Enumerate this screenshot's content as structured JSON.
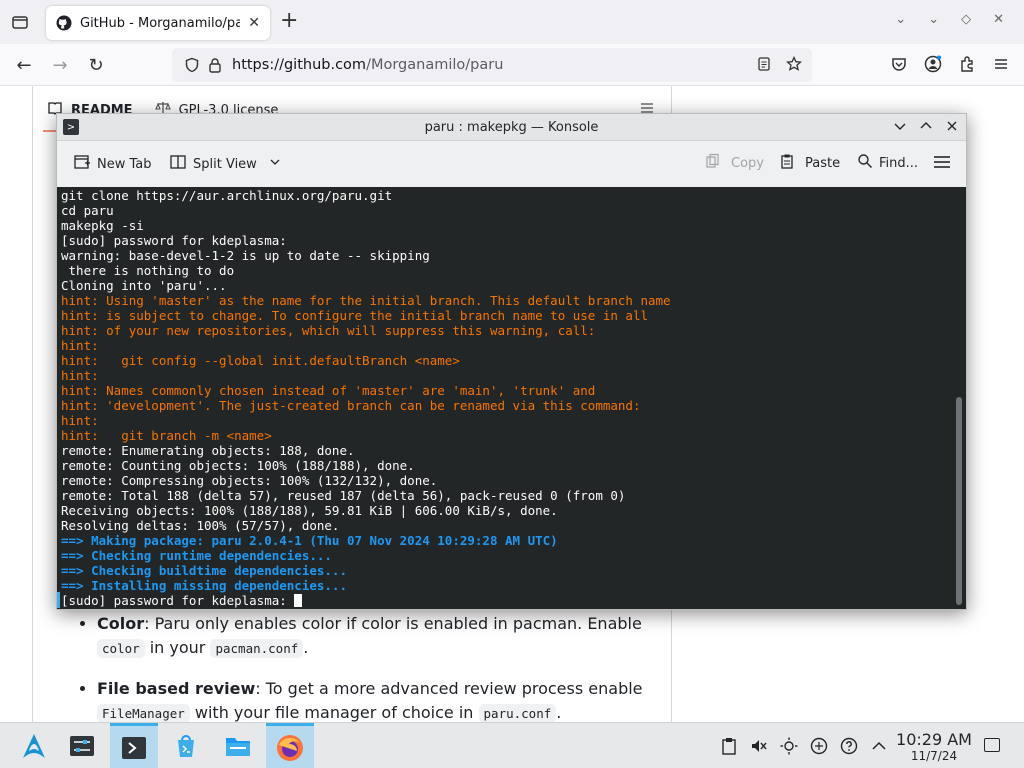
{
  "browser": {
    "tab_title": "GitHub - Morganamilo/paru",
    "url_host": "https://github.com",
    "url_path": "/Morganamilo/paru"
  },
  "github": {
    "tabs": [
      "README",
      "GPL-3.0 license"
    ],
    "readme_items": [
      {
        "bold": "Color",
        "text1": ": Paru only enables color if color is enabled in pacman. Enable ",
        "code1": "color",
        "text2": " in your ",
        "code2": "pacman.conf",
        "text3": "."
      },
      {
        "bold": "File based review",
        "text1": ": To get a more advanced review process enable ",
        "code1": "FileManager",
        "text2": " with your file manager of choice in ",
        "code2": "paru.conf",
        "text3": "."
      }
    ]
  },
  "konsole": {
    "title": "paru : makepkg — Konsole",
    "toolbar": {
      "new_tab": "New Tab",
      "split_view": "Split View",
      "copy": "Copy",
      "paste": "Paste",
      "find": "Find..."
    },
    "lines": [
      {
        "text": "git clone https://aur.archlinux.org/paru.git",
        "color": "white"
      },
      {
        "text": "cd paru",
        "color": "white"
      },
      {
        "text": "makepkg -si",
        "color": "white"
      },
      {
        "text": "[sudo] password for kdeplasma:",
        "color": "white"
      },
      {
        "text": "warning: base-devel-1-2 is up to date -- skipping",
        "color": "white"
      },
      {
        "text": " there is nothing to do",
        "color": "white"
      },
      {
        "text": "Cloning into 'paru'...",
        "color": "white"
      },
      {
        "text": "hint: Using 'master' as the name for the initial branch. This default branch name",
        "color": "orange"
      },
      {
        "text": "hint: is subject to change. To configure the initial branch name to use in all",
        "color": "orange"
      },
      {
        "text": "hint: of your new repositories, which will suppress this warning, call:",
        "color": "orange"
      },
      {
        "text": "hint:",
        "color": "orange"
      },
      {
        "text": "hint:   git config --global init.defaultBranch <name>",
        "color": "orange"
      },
      {
        "text": "hint:",
        "color": "orange"
      },
      {
        "text": "hint: Names commonly chosen instead of 'master' are 'main', 'trunk' and",
        "color": "orange"
      },
      {
        "text": "hint: 'development'. The just-created branch can be renamed via this command:",
        "color": "orange"
      },
      {
        "text": "hint:",
        "color": "orange"
      },
      {
        "text": "hint:   git branch -m <name>",
        "color": "orange"
      },
      {
        "text": "remote: Enumerating objects: 188, done.",
        "color": "white"
      },
      {
        "text": "remote: Counting objects: 100% (188/188), done.",
        "color": "white"
      },
      {
        "text": "remote: Compressing objects: 100% (132/132), done.",
        "color": "white"
      },
      {
        "text": "remote: Total 188 (delta 57), reused 187 (delta 56), pack-reused 0 (from 0)",
        "color": "white"
      },
      {
        "text": "Receiving objects: 100% (188/188), 59.81 KiB | 606.00 KiB/s, done.",
        "color": "white"
      },
      {
        "text": "Resolving deltas: 100% (57/57), done.",
        "color": "white"
      },
      {
        "text": "==> Making package: paru 2.0.4-1 (Thu 07 Nov 2024 10:29:28 AM UTC)",
        "color": "blue"
      },
      {
        "text": "==> Checking runtime dependencies...",
        "color": "blue"
      },
      {
        "text": "==> Checking buildtime dependencies...",
        "color": "blue"
      },
      {
        "text": "==> Installing missing dependencies...",
        "color": "blue"
      }
    ],
    "prompt": "[sudo] password for kdeplasma: "
  },
  "taskbar": {
    "time": "10:29 AM",
    "date": "11/7/24",
    "apps": [
      "app-launcher-icon",
      "system-settings-icon",
      "konsole-icon",
      "discover-icon",
      "dolphin-icon",
      "firefox-icon"
    ]
  },
  "colors": {
    "terminal_bg": "#232627",
    "terminal_fg": "#fcfcfc",
    "hint_orange": "#f67400",
    "makepkg_blue": "#1d99f3",
    "kde_accent": "#3daee9"
  }
}
